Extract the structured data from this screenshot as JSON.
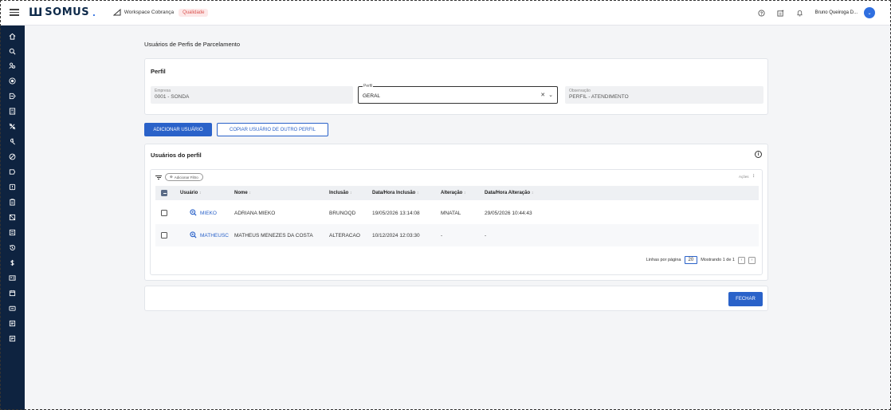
{
  "brand": {
    "logo_mark": "Ш",
    "logo_text": "SOMUS",
    "logo_dot": "."
  },
  "header": {
    "workspace": "Workspace Cobrança",
    "environment": "Qualidade",
    "user_name": "Bruno Queiroga D...",
    "icons": [
      "help-icon",
      "notes-icon",
      "bell-icon"
    ]
  },
  "page": {
    "title": "Usuários de Perfis de Parcelamento"
  },
  "perfil_card": {
    "title": "Perfil",
    "empresa_label": "Empresa",
    "empresa_value": "0001 - SONDA",
    "perfil_label": "Perfil",
    "perfil_value": "GERAL",
    "observacao_label": "Observação",
    "observacao_value": "PERFIL - ATENDIMENTO"
  },
  "actions": {
    "add_user": "ADICIONAR USUÁRIO",
    "copy_user": "COPIAR USUÁRIO DE OUTRO PERFIL"
  },
  "users_card": {
    "title": "Usuários do perfil",
    "filter_chip": "Adicionar Filtro",
    "acoes": "Ações",
    "columns": [
      "Usuário",
      "Nome",
      "Inclusão",
      "Data/Hora Inclusão",
      "Alteração",
      "Data/Hora Alteração"
    ],
    "sort_glyph": "↕",
    "rows": [
      {
        "usuario": "MIEKO",
        "nome": "ADRIANA MIEKO",
        "inclusao": "BRUNOQD",
        "data_inclusao": "19/05/2026 13:14:08",
        "alteracao": "MNATAL",
        "data_alteracao": "29/05/2026 10:44:43"
      },
      {
        "usuario": "MATHEUSC",
        "nome": "MATHEUS MENEZES DA COSTA",
        "inclusao": "ALTERACAO",
        "data_inclusao": "10/12/2024 12:03:30",
        "alteracao": "-",
        "data_alteracao": "-"
      }
    ],
    "pagination": {
      "rows_label": "Linhas por página",
      "rows_value": "20",
      "showing": "Mostrando 1 de 1"
    }
  },
  "footer": {
    "close": "FECHAR"
  },
  "colors": {
    "accent": "#2a62c9",
    "sidebar": "#0e2340",
    "badge": "#d9534f"
  },
  "sidebar_icons": [
    "home-icon",
    "search-icon",
    "users-icon",
    "target-icon",
    "send-icon",
    "calculator-icon",
    "no-percent-icon",
    "tool-icon",
    "block-icon",
    "tag-icon",
    "alert-icon",
    "clipboard-icon",
    "card-icon",
    "document-icon",
    "history-icon",
    "dollar-icon",
    "id-card-icon",
    "calendar-icon",
    "wallet-icon",
    "list-icon",
    "note-icon"
  ]
}
